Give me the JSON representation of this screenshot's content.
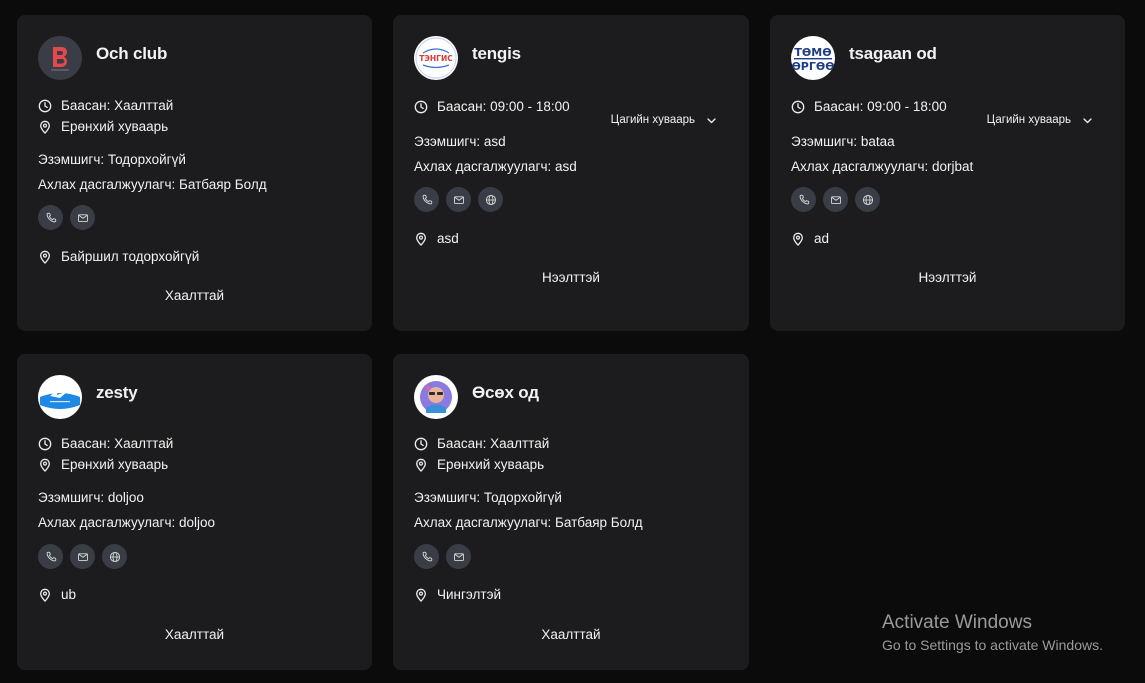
{
  "cards": [
    {
      "name": "Och club",
      "hours": "Баасан: Хаалттай",
      "schedule_label": "Ерөнхий хуваарь",
      "owner": "Эзэмшигч: Тодорхойгүй",
      "trainer": "Ахлах дасгалжуулагч: Батбаяр Болд",
      "location": "Байршил тодорхойгүй",
      "status": "Хаалттай",
      "logo_text": "B",
      "brand_color": "#e5484d"
    },
    {
      "name": "tengis",
      "hours": "Баасан: 09:00 - 18:00",
      "schedule_dropdown": "Цагийн хуваарь",
      "owner": "Эзэмшигч: asd",
      "trainer": "Ахлах дасгалжуулагч: asd",
      "location": "asd",
      "status": "Нээлттэй",
      "logo_text": "ТЭНГИС"
    },
    {
      "name": "tsagaan od",
      "hours": "Баасан: 09:00 - 18:00",
      "schedule_dropdown": "Цагийн хуваарь",
      "owner": "Эзэмшигч: bataa",
      "trainer": "Ахлах дасгалжуулагч: dorjbat",
      "location": "ad",
      "status": "Нээлттэй",
      "logo_line1": "ТӨМӨ",
      "logo_line2": "ӨРГӨӨ"
    },
    {
      "name": "zesty",
      "hours": "Баасан: Хаалттай",
      "schedule_label": "Ерөнхий хуваарь",
      "owner": "Эзэмшигч: doljoo",
      "trainer": "Ахлах дасгалжуулагч: doljoo",
      "location": "ub",
      "status": "Хаалттай"
    },
    {
      "name": "Өсөх од",
      "hours": "Баасан: Хаалттай",
      "schedule_label": "Ерөнхий хуваарь",
      "owner": "Эзэмшигч: Тодорхойгүй",
      "trainer": "Ахлах дасгалжуулагч: Батбаяр Болд",
      "location": "Чингэлтэй",
      "status": "Хаалттай"
    }
  ],
  "icons": {
    "hours": "clock-icon",
    "schedule": "map-pin-icon",
    "location": "map-pin-icon",
    "phone": "phone-icon",
    "email": "mail-icon",
    "website": "globe-icon",
    "dropdown": "chevron-down-icon"
  },
  "watermark": {
    "title": "Activate Windows",
    "subtitle": "Go to Settings to activate Windows."
  }
}
